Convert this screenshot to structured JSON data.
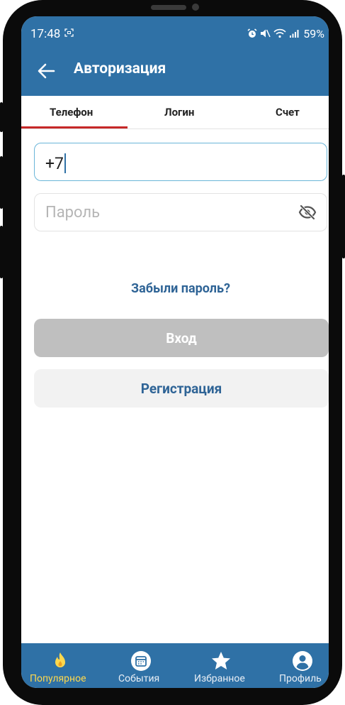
{
  "status_bar": {
    "time": "17:48",
    "battery": "59%"
  },
  "app_bar": {
    "title": "Авторизация"
  },
  "tabs": [
    {
      "label": "Телефон",
      "active": true
    },
    {
      "label": "Логин",
      "active": false
    },
    {
      "label": "Счет",
      "active": false
    }
  ],
  "form": {
    "phone_value": "+7",
    "password_placeholder": "Пароль",
    "forgot_password": "Забыли пароль?",
    "login_button": "Вход",
    "register_button": "Регистрация"
  },
  "bottom_nav": [
    {
      "label": "Популярное",
      "icon": "fire-icon",
      "active": true
    },
    {
      "label": "События",
      "icon": "calendar-icon",
      "active": false
    },
    {
      "label": "Избранное",
      "icon": "star-icon",
      "active": false
    },
    {
      "label": "Профиль",
      "icon": "profile-icon",
      "active": false
    }
  ],
  "colors": {
    "primary": "#2f71a6",
    "tab_indicator": "#c62828",
    "link": "#2f6496",
    "nav_active": "#ffd84d",
    "button_disabled": "#bfbfbf"
  }
}
